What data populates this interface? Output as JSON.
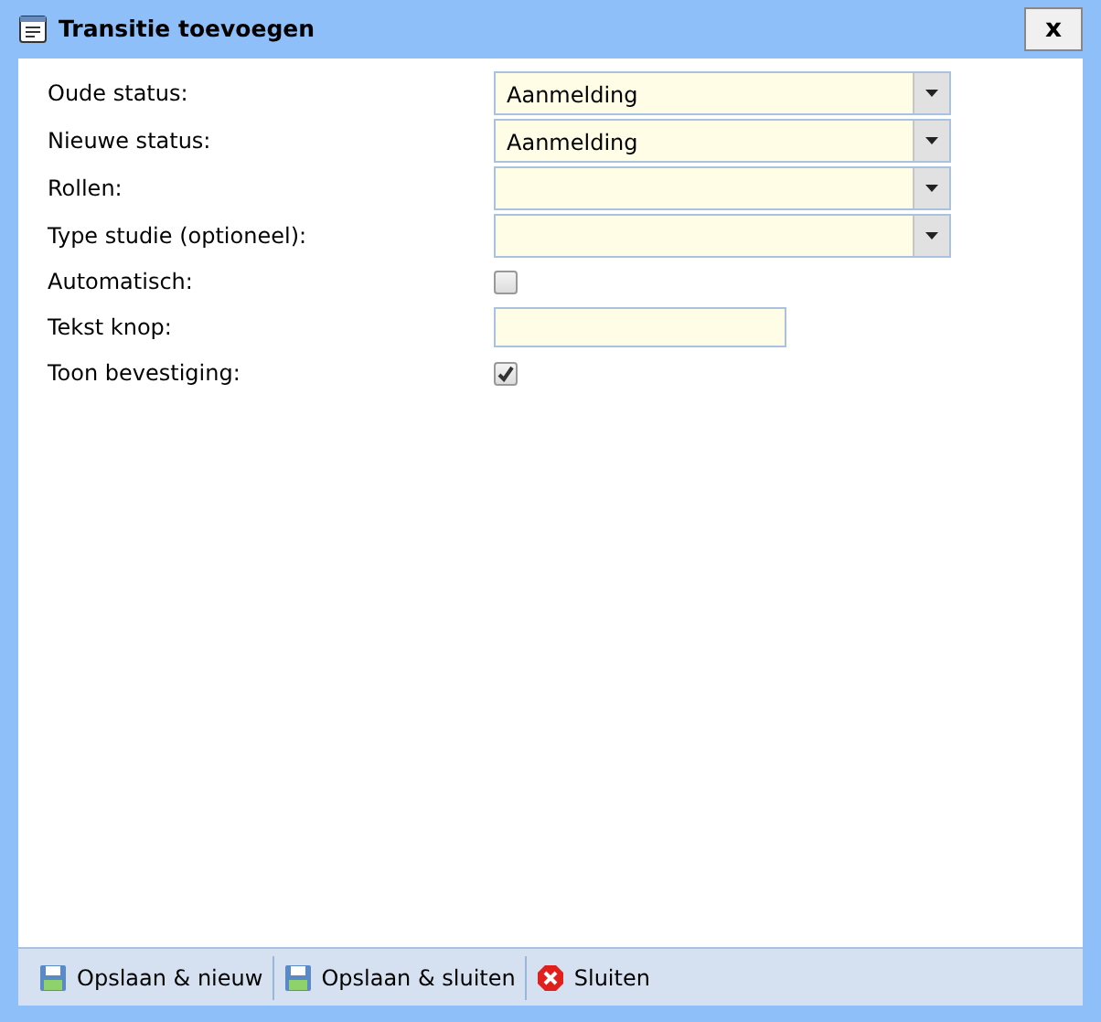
{
  "window": {
    "title": "Transitie toevoegen",
    "close_label": "x"
  },
  "fields": [
    {
      "kind": "select",
      "label": "Oude status:",
      "value": "Aanmelding"
    },
    {
      "kind": "select",
      "label": "Nieuwe status:",
      "value": "Aanmelding"
    },
    {
      "kind": "select",
      "label": "Rollen:"
    },
    {
      "kind": "select",
      "label": "Type studie (optioneel):"
    },
    {
      "kind": "checkbox",
      "label": "Automatisch:",
      "checked": false
    },
    {
      "kind": "text",
      "label": "Tekst knop:"
    },
    {
      "kind": "checkbox",
      "label": "Toon bevestiging:",
      "checked": true
    }
  ],
  "buttons": [
    {
      "kind": "save",
      "label": "Opslaan & nieuw"
    },
    {
      "kind": "save",
      "label": "Opslaan & sluiten"
    },
    {
      "kind": "close",
      "label": "Sluiten"
    }
  ]
}
